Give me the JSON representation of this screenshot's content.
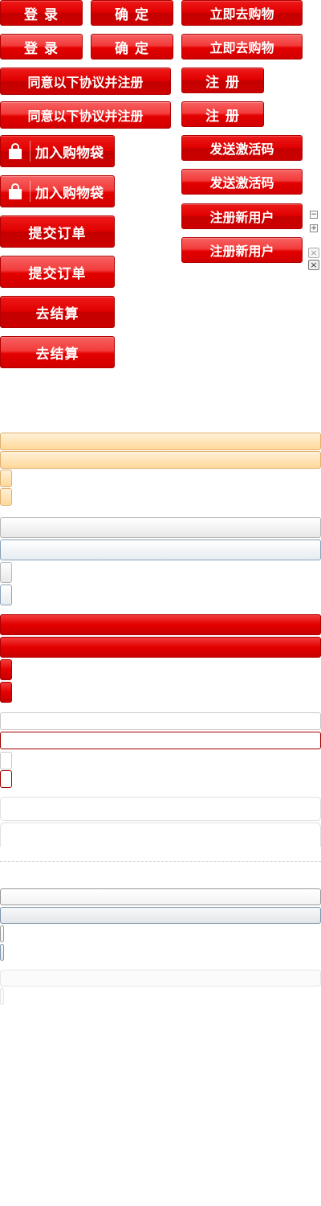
{
  "buttons": {
    "login": "登 录",
    "confirm": "确 定",
    "buy_now": "立即去购物",
    "agree_register": "同意以下协议并注册",
    "register": "注 册",
    "add_to_bag": "加入购物袋",
    "send_activation": "发送激活码",
    "submit_order": "提交订单",
    "register_new_user": "注册新用户",
    "checkout": "去结算"
  },
  "icons": {
    "collapse": "−",
    "expand": "+",
    "close": "×"
  },
  "colors": {
    "button_red": "#e00000",
    "button_border": "#b10000",
    "highlight_orange": "#ffd89a"
  }
}
